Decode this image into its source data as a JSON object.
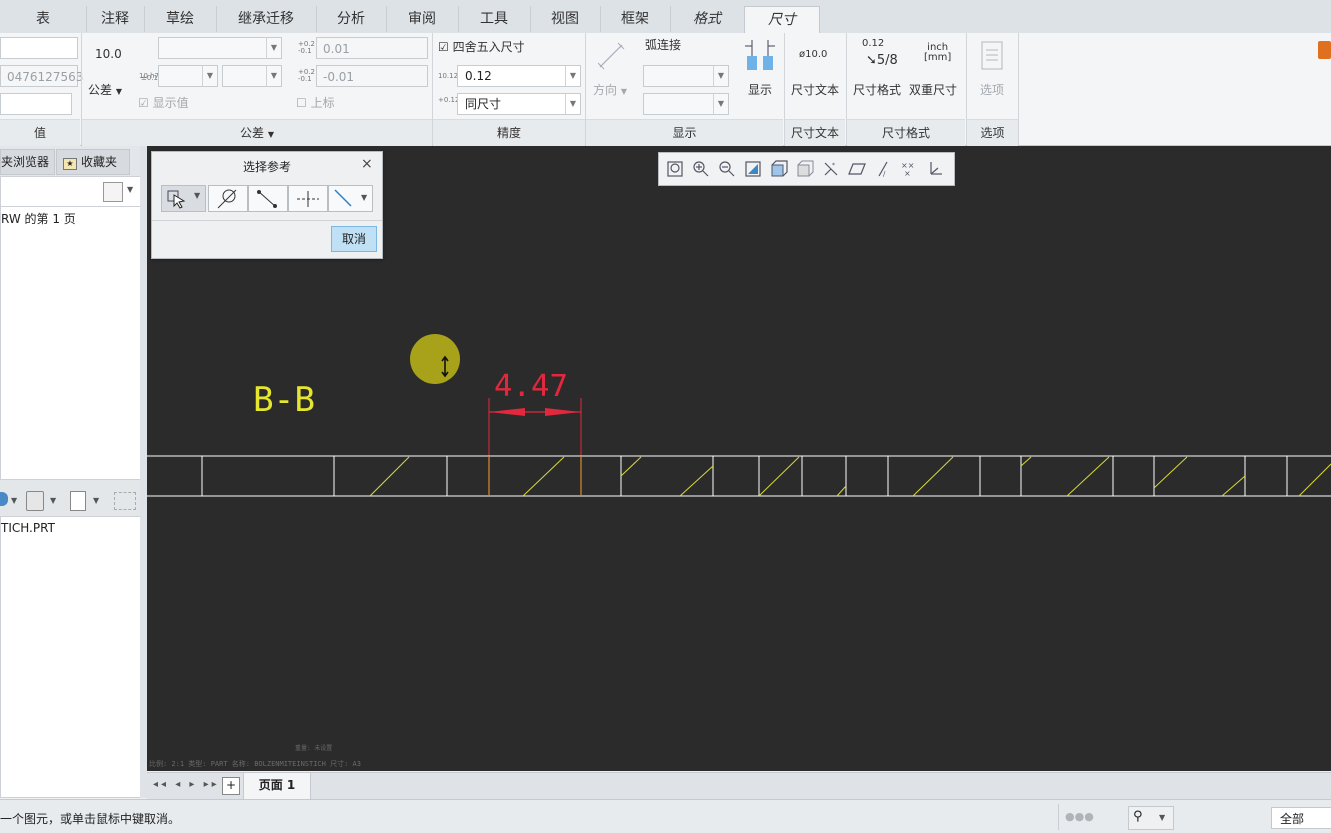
{
  "tabs": [
    {
      "label": "表"
    },
    {
      "label": "注释"
    },
    {
      "label": "草绘"
    },
    {
      "label": "继承迁移"
    },
    {
      "label": "分析"
    },
    {
      "label": "审阅"
    },
    {
      "label": "工具"
    },
    {
      "label": "视图"
    },
    {
      "label": "框架"
    },
    {
      "label": "格式"
    },
    {
      "label": "尺寸"
    }
  ],
  "ribbon": {
    "value_group": {
      "field2": "0476127563",
      "label": "值"
    },
    "tolerance_group": {
      "nominal": "10.0",
      "tol_button": "公差",
      "upper_val": "0.01",
      "lower_val": "-0.01",
      "show_value": "显示值",
      "superscript": "上标",
      "label": "公差",
      "mini1": "+0.1 / ±0.1",
      "mini2": "10 h7"
    },
    "precision_group": {
      "round_label": "四舍五入尺寸",
      "precision_value": "0.12",
      "precision_mini": "10.123",
      "tol_precision": "同尺寸",
      "tol_mini": "+0.123 -0.123",
      "label": "精度"
    },
    "display_group": {
      "direction": "方向",
      "arc": "弧连接",
      "show_button": "显示",
      "label": "显示"
    },
    "dimtext_group": {
      "icon_text": "ø10.0",
      "button": "尺寸文本",
      "label": "尺寸文本"
    },
    "dimformat_group": {
      "format_mini": "0.12",
      "format_fraction": "5/8",
      "format_button": "尺寸格式",
      "dual_top": "inch",
      "dual_bottom": "[mm]",
      "dual_button": "双重尺寸",
      "label": "尺寸格式"
    },
    "options_group": {
      "button": "选项",
      "label": "选项"
    }
  },
  "left_panel": {
    "tab_browser": "夹浏览器",
    "tab_favorites": "收藏夹",
    "tree_item": "RW 的第 1 页",
    "model_item": "TICH.PRT"
  },
  "select_dialog": {
    "title": "选择参考",
    "cancel": "取消"
  },
  "drawing": {
    "section_label": "B-B",
    "dimension_value": "4.47",
    "title_block": "比例: 2:1     类型: PART    名称: BOLZENMITEINSTICH   尺寸: A3",
    "title_block_top": "重量: 未设置"
  },
  "page_bar": {
    "page_tab": "页面 1",
    "add": "+"
  },
  "status": {
    "message": "一个图元，或单击鼠标中键取消。",
    "filter": "全部"
  },
  "colors": {
    "canvas_bg": "#2b2b2b",
    "section_label": "#e6e62e",
    "dimension": "#e2283c",
    "geometry": "#ffffff",
    "hatch": "#d8d83a",
    "cursor_highlight": "#a7a21a"
  }
}
